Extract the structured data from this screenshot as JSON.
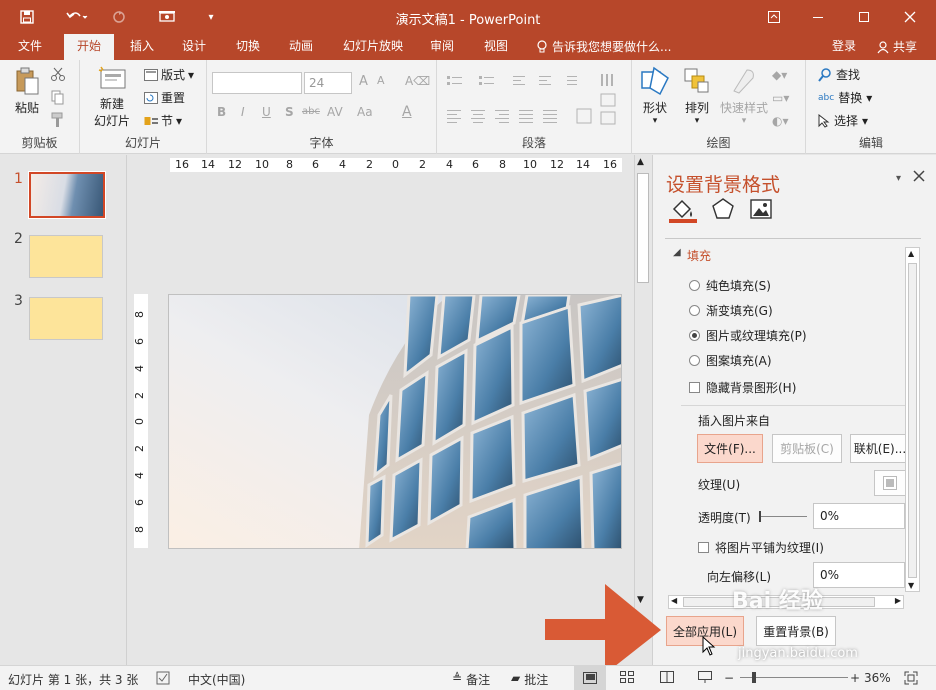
{
  "window": {
    "title": "演示文稿1 - PowerPoint"
  },
  "tabs": [
    {
      "label": "文件"
    },
    {
      "label": "开始"
    },
    {
      "label": "插入"
    },
    {
      "label": "设计"
    },
    {
      "label": "切换"
    },
    {
      "label": "动画"
    },
    {
      "label": "幻灯片放映"
    },
    {
      "label": "审阅"
    },
    {
      "label": "视图"
    }
  ],
  "tell_me": "告诉我您想要做什么...",
  "account": {
    "login": "登录",
    "share": "共享"
  },
  "ribbon": {
    "clipboard": {
      "label": "剪贴板",
      "paste": "粘贴"
    },
    "slides": {
      "label": "幻灯片",
      "new_slide_1": "新建",
      "new_slide_2": "幻灯片",
      "layout": "版式",
      "reset": "重置",
      "section": "节"
    },
    "font": {
      "label": "字体",
      "size": "24",
      "bold": "B",
      "italic": "I",
      "underline": "U",
      "shadow": "S",
      "strike": "abc",
      "spacing": "AV",
      "grow": "A",
      "case": "Aa",
      "color": "A"
    },
    "paragraph": {
      "label": "段落"
    },
    "drawing": {
      "label": "绘图",
      "shape": "形状",
      "arrange": "排列",
      "quick_styles": "快速样式"
    },
    "editing": {
      "label": "编辑",
      "find": "查找",
      "replace": "替换",
      "select": "选择"
    }
  },
  "slides_panel": {
    "numbers": [
      "1",
      "2",
      "3"
    ]
  },
  "rulers": {
    "horizontal": [
      "16",
      "14",
      "12",
      "10",
      "8",
      "6",
      "4",
      "2",
      "0",
      "2",
      "4",
      "6",
      "8",
      "10",
      "12",
      "14",
      "16"
    ],
    "vertical": [
      "8",
      "6",
      "4",
      "2",
      "0",
      "2",
      "4",
      "6",
      "8"
    ]
  },
  "format_pane": {
    "title": "设置背景格式",
    "section": "填充",
    "options": [
      {
        "label": "纯色填充(S)",
        "selected": false
      },
      {
        "label": "渐变填充(G)",
        "selected": false
      },
      {
        "label": "图片或纹理填充(P)",
        "selected": true
      },
      {
        "label": "图案填充(A)",
        "selected": false
      }
    ],
    "hide_bg": "隐藏背景图形(H)",
    "insert_from": "插入图片来自",
    "file_btn": "文件(F)...",
    "clipboard_btn": "剪贴板(C)",
    "online_btn": "联机(E)...",
    "texture_label": "纹理(U)",
    "transparency_label": "透明度(T)",
    "transparency_value": "0%",
    "tile_label": "将图片平铺为纹理(I)",
    "offset_left_label": "向左偏移(L)",
    "offset_left_value": "0%",
    "apply_all": "全部应用(L)",
    "reset_bg": "重置背景(B)"
  },
  "statusbar": {
    "slide_info": "幻灯片 第 1 张，共 3 张",
    "language": "中文(中国)",
    "notes": "备注",
    "comments": "批注",
    "zoom": "36%"
  },
  "watermark": {
    "site": "jingyan.baidu.com",
    "brand": "Bai 经验"
  },
  "colors": {
    "accent": "#b7472a",
    "pane_title": "#c5502c",
    "arrow": "#d95a35",
    "thumb_fill": "#fde49a"
  }
}
